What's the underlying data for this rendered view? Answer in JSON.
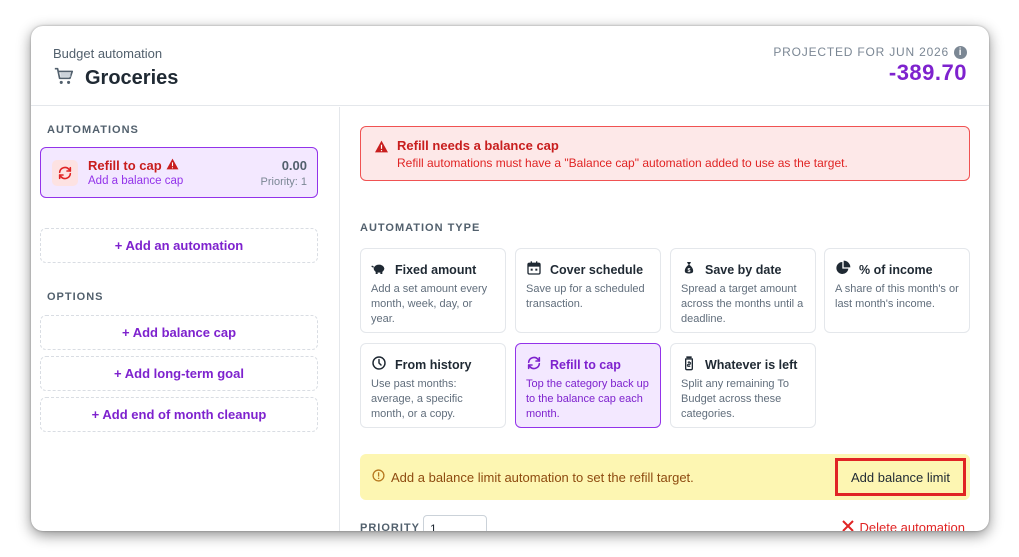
{
  "header": {
    "eyebrow": "Budget automation",
    "title": "Groceries",
    "title_icon": "shopping-cart-icon",
    "projected_label": "PROJECTED FOR JUN 2026",
    "projected_value": "-389.70",
    "accent_color": "#7e22ce"
  },
  "sidebar": {
    "automations_label": "AUTOMATIONS",
    "automation": {
      "name": "Refill to cap",
      "subtitle": "Add a balance cap",
      "amount": "0.00",
      "priority": "Priority: 1",
      "icon": "refresh-icon",
      "status_icon": "warning-icon"
    },
    "add_automation": "+ Add an automation",
    "options_label": "OPTIONS",
    "options": [
      "+ Add balance cap",
      "+ Add long-term goal",
      "+ Add end of month cleanup"
    ]
  },
  "alert": {
    "title": "Refill needs a balance cap",
    "body": "Refill automations must have a \"Balance cap\" automation added to use as the target."
  },
  "automation_type": {
    "label": "AUTOMATION TYPE",
    "selected": "Refill to cap",
    "cards": [
      {
        "title": "Fixed amount",
        "desc": "Add a set amount every month, week, day, or year.",
        "icon": "piggy-bank-icon"
      },
      {
        "title": "Cover schedule",
        "desc": "Save up for a scheduled transaction.",
        "icon": "calendar-icon"
      },
      {
        "title": "Save by date",
        "desc": "Spread a target amount across the months until a deadline.",
        "icon": "money-bag-icon"
      },
      {
        "title": "% of income",
        "desc": "A share of this month's or last month's income.",
        "icon": "pie-chart-icon"
      },
      {
        "title": "From history",
        "desc": "Use past months: average, a specific month, or a copy.",
        "icon": "clock-icon"
      },
      {
        "title": "Refill to cap",
        "desc": "Top the category back up to the balance cap each month.",
        "icon": "refresh-icon"
      },
      {
        "title": "Whatever is left",
        "desc": "Split any remaining To Budget across these categories.",
        "icon": "jar-icon"
      }
    ]
  },
  "warning": {
    "text": "Add a balance limit automation to set the refill target.",
    "button": "Add balance limit"
  },
  "footer": {
    "priority_label": "PRIORITY",
    "priority_value": "1",
    "delete_label": "Delete automation"
  }
}
